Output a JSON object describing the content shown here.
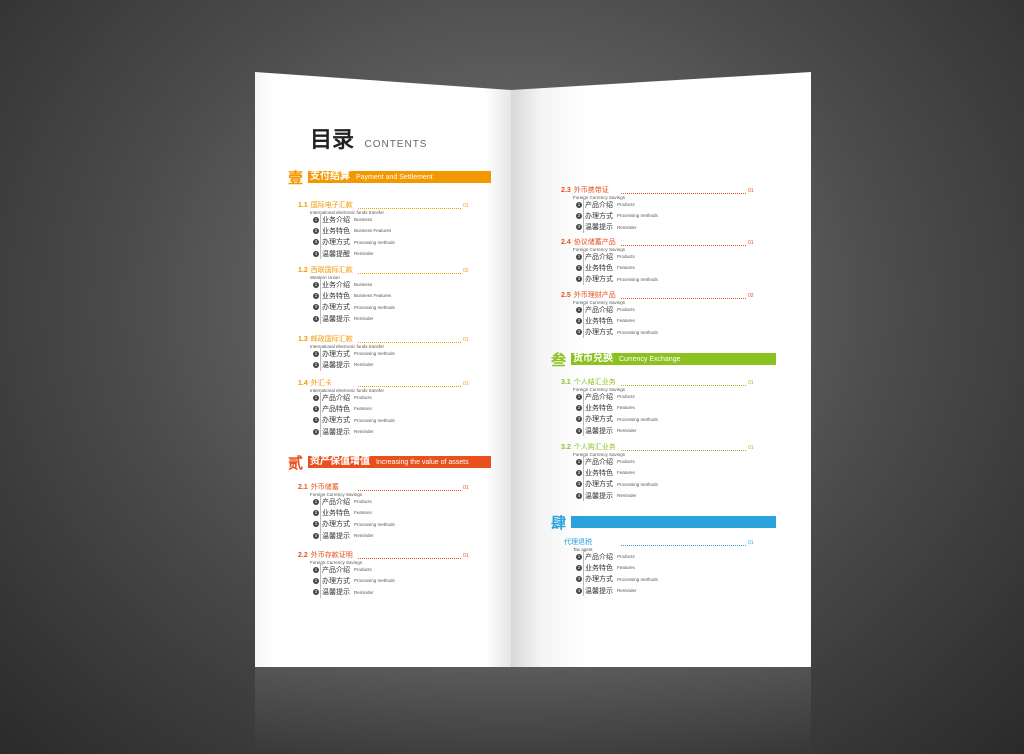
{
  "colors": {
    "orange": "#f39800",
    "red_orange": "#e8501e",
    "green": "#8cc220",
    "blue": "#2aa3dc"
  },
  "toc": {
    "title": "目录",
    "subtitle": "CONTENTS"
  },
  "sections": [
    {
      "numeral": "壹",
      "title": "支付结算",
      "en": "Payment and Settlement",
      "color": "#f39800",
      "subs": [
        {
          "num": "1.1",
          "title": "国际电子汇款",
          "en": "International electronic funds transfer",
          "page": "01",
          "items": [
            [
              "业务介绍",
              "Business"
            ],
            [
              "业务特色",
              "Business Features"
            ],
            [
              "办理方式",
              "Processing methods"
            ],
            [
              "温馨提醒",
              "Reminder"
            ]
          ]
        },
        {
          "num": "1.2",
          "title": "西联国际汇款",
          "en": "Western Union",
          "page": "02",
          "items": [
            [
              "业务介绍",
              "Business"
            ],
            [
              "业务特色",
              "Business Features"
            ],
            [
              "办理方式",
              "Processing methods"
            ],
            [
              "温馨提示",
              "Reminder"
            ]
          ]
        },
        {
          "num": "1.3",
          "title": "邮政国际汇款",
          "en": "International electronic funds transfer",
          "page": "01",
          "items": [
            [
              "办理方式",
              "Processing methods"
            ],
            [
              "温馨提示",
              "Reminder"
            ]
          ]
        },
        {
          "num": "1.4",
          "title": "外汇卡",
          "en": "International electronic funds transfer",
          "page": "01",
          "items": [
            [
              "产品介绍",
              "Products"
            ],
            [
              "产品特色",
              "Features"
            ],
            [
              "办理方式",
              "Processing methods"
            ],
            [
              "温馨提示",
              "Reminder"
            ]
          ]
        }
      ]
    },
    {
      "numeral": "贰",
      "title": "资产保值增值",
      "en": "Increasing the value of assets",
      "color": "#e8501e",
      "subs": [
        {
          "num": "2.1",
          "title": "外币储蓄",
          "en": "Foreign Currency Savings",
          "page": "01",
          "items": [
            [
              "产品介绍",
              "Products"
            ],
            [
              "业务特色",
              "Features"
            ],
            [
              "办理方式",
              "Processing methods"
            ],
            [
              "温馨提示",
              "Reminder"
            ]
          ]
        },
        {
          "num": "2.2",
          "title": "外币存款证明",
          "en": "Foreign Currency Savings",
          "page": "01",
          "items": [
            [
              "产品介绍",
              "Products"
            ],
            [
              "办理方式",
              "Processing methods"
            ],
            [
              "温馨提示",
              "Reminder"
            ]
          ]
        },
        {
          "num": "2.3",
          "title": "外币携带证",
          "en": "Foreign Currency Savings",
          "page": "01",
          "items": [
            [
              "产品介绍",
              "Products"
            ],
            [
              "办理方式",
              "Processing methods"
            ],
            [
              "温馨提示",
              "Reminder"
            ]
          ]
        },
        {
          "num": "2.4",
          "title": "协议储蓄产品",
          "en": "Foreign Currency Savings",
          "page": "01",
          "items": [
            [
              "产品介绍",
              "Products"
            ],
            [
              "业务特色",
              "Features"
            ],
            [
              "办理方式",
              "Processing methods"
            ]
          ]
        },
        {
          "num": "2.5",
          "title": "外币理财产品",
          "en": "Foreign Currency Savings",
          "page": "02",
          "items": [
            [
              "产品介绍",
              "Products"
            ],
            [
              "业务特色",
              "Features"
            ],
            [
              "办理方式",
              "Processing methods"
            ]
          ]
        }
      ]
    },
    {
      "numeral": "叁",
      "title": "货币兑换",
      "en": "Currency Exchange",
      "color": "#8cc220",
      "subs": [
        {
          "num": "3.1",
          "title": "个人结汇业务",
          "en": "Foreign Currency Savings",
          "page": "01",
          "items": [
            [
              "产品介绍",
              "Products"
            ],
            [
              "业务特色",
              "Features"
            ],
            [
              "办理方式",
              "Processing methods"
            ],
            [
              "温馨提示",
              "Reminder"
            ]
          ]
        },
        {
          "num": "3.2",
          "title": "个人购汇业务",
          "en": "Foreign Currency Savings",
          "page": "01",
          "items": [
            [
              "产品介绍",
              "Products"
            ],
            [
              "业务特色",
              "Features"
            ],
            [
              "办理方式",
              "Processing methods"
            ],
            [
              "温馨提示",
              "Reminder"
            ]
          ]
        }
      ]
    },
    {
      "numeral": "肆",
      "title": "",
      "en": "",
      "color": "#2aa3dc",
      "subs": [
        {
          "num": "",
          "title": "代理退税",
          "en": "Tax agent",
          "page": "01",
          "items": [
            [
              "产品介绍",
              "Products"
            ],
            [
              "业务特色",
              "Features"
            ],
            [
              "办理方式",
              "Processing methods"
            ],
            [
              "温馨提示",
              "Reminder"
            ]
          ]
        }
      ]
    }
  ]
}
